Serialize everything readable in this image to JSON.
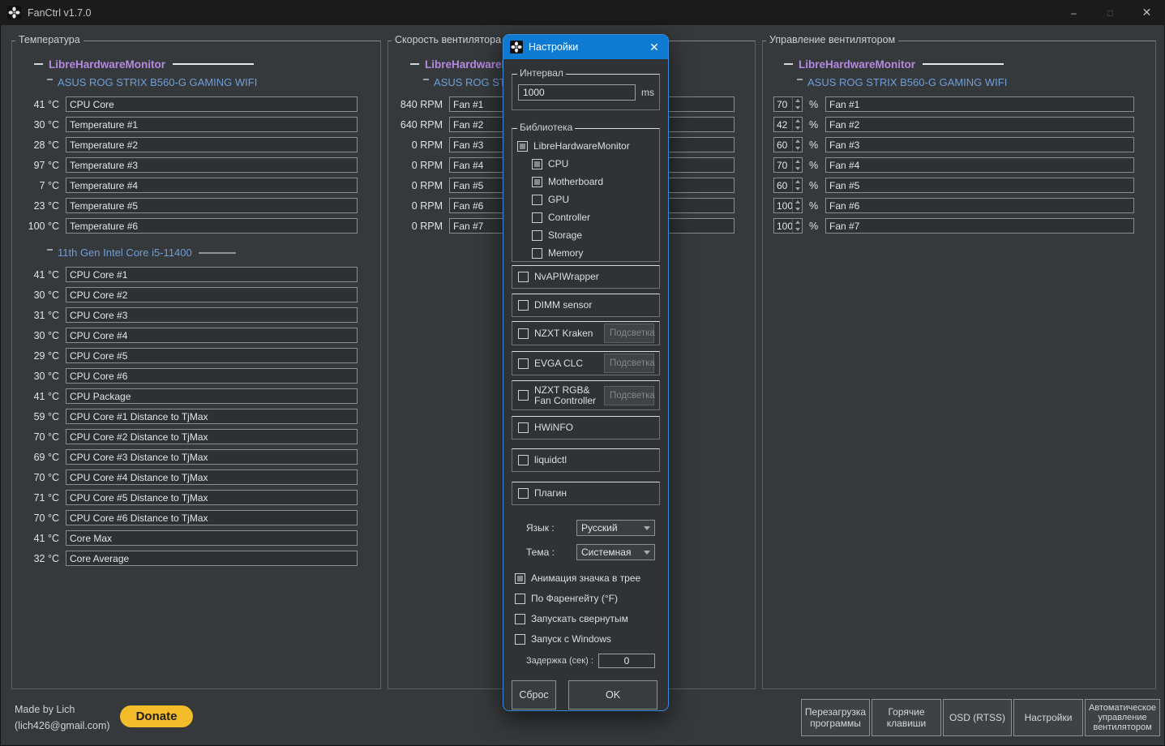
{
  "window": {
    "title": "FanCtrl v1.7.0",
    "controls": {
      "minimize": "–",
      "maximize": "□",
      "close": "✕"
    }
  },
  "colors": {
    "accent-purple": "#b28ae0",
    "accent-blue": "#6f9ed9",
    "dialog-title": "#0f7ad2",
    "donate": "#f4bb2b"
  },
  "panels": {
    "temperature": {
      "title": "Температура",
      "unit": "°C",
      "source": "LibreHardwareMonitor",
      "groups": [
        {
          "name": "ASUS ROG STRIX B560-G GAMING WIFI",
          "trail": false,
          "rows": [
            {
              "value": "41",
              "label": "CPU Core"
            },
            {
              "value": "30",
              "label": "Temperature #1"
            },
            {
              "value": "28",
              "label": "Temperature #2"
            },
            {
              "value": "97",
              "label": "Temperature #3"
            },
            {
              "value": "7",
              "label": "Temperature #4"
            },
            {
              "value": "23",
              "label": "Temperature #5"
            },
            {
              "value": "100",
              "label": "Temperature #6"
            }
          ]
        },
        {
          "name": "11th Gen Intel Core i5-11400",
          "trail": true,
          "rows": [
            {
              "value": "41",
              "label": "CPU Core #1"
            },
            {
              "value": "30",
              "label": "CPU Core #2"
            },
            {
              "value": "31",
              "label": "CPU Core #3"
            },
            {
              "value": "30",
              "label": "CPU Core #4"
            },
            {
              "value": "29",
              "label": "CPU Core #5"
            },
            {
              "value": "30",
              "label": "CPU Core #6"
            },
            {
              "value": "41",
              "label": "CPU Package"
            },
            {
              "value": "59",
              "label": "CPU Core #1 Distance to TjMax"
            },
            {
              "value": "70",
              "label": "CPU Core #2 Distance to TjMax"
            },
            {
              "value": "69",
              "label": "CPU Core #3 Distance to TjMax"
            },
            {
              "value": "70",
              "label": "CPU Core #4 Distance to TjMax"
            },
            {
              "value": "71",
              "label": "CPU Core #5 Distance to TjMax"
            },
            {
              "value": "70",
              "label": "CPU Core #6 Distance to TjMax"
            },
            {
              "value": "41",
              "label": "Core Max"
            },
            {
              "value": "32",
              "label": "Core Average"
            }
          ]
        }
      ]
    },
    "fan_speed": {
      "title": "Скорость вентилятора",
      "unit": "RPM",
      "source": "LibreHardwareMonitor",
      "groups": [
        {
          "name": "ASUS ROG STRIX B560-G GAMING WIFI",
          "trail": false,
          "rows": [
            {
              "value": "840",
              "label": "Fan #1"
            },
            {
              "value": "640",
              "label": "Fan #2"
            },
            {
              "value": "0",
              "label": "Fan #3"
            },
            {
              "value": "0",
              "label": "Fan #4"
            },
            {
              "value": "0",
              "label": "Fan #5"
            },
            {
              "value": "0",
              "label": "Fan #6"
            },
            {
              "value": "0",
              "label": "Fan #7"
            }
          ]
        }
      ]
    },
    "fan_control": {
      "title": "Управление вентилятором",
      "unit": "%",
      "source": "LibreHardwareMonitor",
      "groups": [
        {
          "name": "ASUS ROG STRIX B560-G GAMING WIFI",
          "trail": false,
          "rows": [
            {
              "value": "70",
              "label": "Fan #1"
            },
            {
              "value": "42",
              "label": "Fan #2"
            },
            {
              "value": "60",
              "label": "Fan #3"
            },
            {
              "value": "70",
              "label": "Fan #4"
            },
            {
              "value": "60",
              "label": "Fan #5"
            },
            {
              "value": "100",
              "label": "Fan #6"
            },
            {
              "value": "100",
              "label": "Fan #7"
            }
          ]
        }
      ]
    }
  },
  "dialog": {
    "title": "Настройки",
    "close": "✕",
    "interval": {
      "label": "Интервал",
      "value": "1000",
      "unit": "ms"
    },
    "library": {
      "label": "Библиотека",
      "tree": [
        {
          "label": "LibreHardwareMonitor",
          "checked": true,
          "child": false
        },
        {
          "label": "CPU",
          "checked": true,
          "child": true
        },
        {
          "label": "Motherboard",
          "checked": true,
          "child": true
        },
        {
          "label": "GPU",
          "checked": false,
          "child": true
        },
        {
          "label": "Controller",
          "checked": false,
          "child": true
        },
        {
          "label": "Storage",
          "checked": false,
          "child": true
        },
        {
          "label": "Memory",
          "checked": false,
          "child": true
        }
      ]
    },
    "libs": [
      {
        "label": "NvAPIWrapper",
        "checked": false
      },
      {
        "label": "DIMM sensor",
        "checked": false
      },
      {
        "label": "NZXT Kraken",
        "checked": false,
        "button": "Подсветка"
      },
      {
        "label": "EVGA CLC",
        "checked": false,
        "button": "Подсветка"
      },
      {
        "label": "NZXT RGB&\nFan Controller",
        "checked": false,
        "button": "Подсветка"
      },
      {
        "label": "HWiNFO",
        "checked": false
      },
      {
        "label": "liquidctl",
        "checked": false
      },
      {
        "label": "Плагин",
        "checked": false
      }
    ],
    "language": {
      "label": "Язык :",
      "value": "Русский"
    },
    "theme": {
      "label": "Тема :",
      "value": "Системная"
    },
    "options": [
      {
        "label": "Анимация значка в трее",
        "checked": true
      },
      {
        "label": "По Фаренгейту (°F)",
        "checked": false
      },
      {
        "label": "Запускать свернутым",
        "checked": false
      },
      {
        "label": "Запуск с Windows",
        "checked": false
      }
    ],
    "delay": {
      "label": "Задержка (сек) :",
      "value": "0"
    },
    "buttons": {
      "reset": "Сброс",
      "ok": "OK"
    }
  },
  "footer": {
    "credit_line1": "Made by Lich",
    "credit_line2": "(lich426@gmail.com)",
    "donate": "Donate",
    "buttons": [
      "Перезагрузка\nпрограммы",
      "Горячие\nклавиши",
      "OSD (RTSS)",
      "Настройки",
      "Автоматическое\nуправление\nвентилятором"
    ]
  }
}
